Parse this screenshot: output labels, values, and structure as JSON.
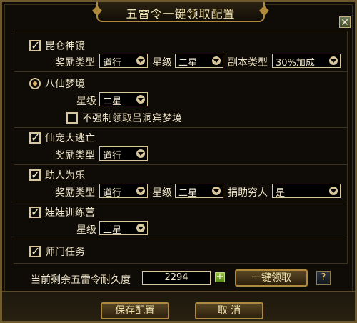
{
  "title": "五雷令一键领取配置",
  "sections": {
    "kunlun": {
      "label": "昆仑神镜",
      "checked": true,
      "reward_type_label": "奖励类型",
      "reward_type_value": "道行",
      "star_label": "星级",
      "star_value": "二星",
      "dungeon_type_label": "副本类型",
      "dungeon_type_value": "30%加成"
    },
    "baxian": {
      "label": "八仙梦境",
      "selected": true,
      "star_label": "星级",
      "star_value": "二星",
      "no_force_label": "不强制领取吕洞宾梦境",
      "no_force_checked": false
    },
    "xianchong": {
      "label": "仙宠大逃亡",
      "checked": true,
      "reward_type_label": "奖励类型",
      "reward_type_value": "道行"
    },
    "zhuren": {
      "label": "助人为乐",
      "checked": true,
      "reward_type_label": "奖励类型",
      "reward_type_value": "道行",
      "star_label": "星级",
      "star_value": "二星",
      "donate_label": "捐助穷人",
      "donate_value": "是"
    },
    "wawa": {
      "label": "娃娃训练营",
      "checked": true,
      "star_label": "星级",
      "star_value": "二星"
    },
    "shimen": {
      "label": "师门任务",
      "checked": true
    }
  },
  "durability": {
    "label": "当前剩余五雷令耐久度",
    "value": "2294"
  },
  "buttons": {
    "one_click": "一键领取",
    "save": "保存配置",
    "cancel": "取 消",
    "help": "?",
    "close": "✕"
  }
}
